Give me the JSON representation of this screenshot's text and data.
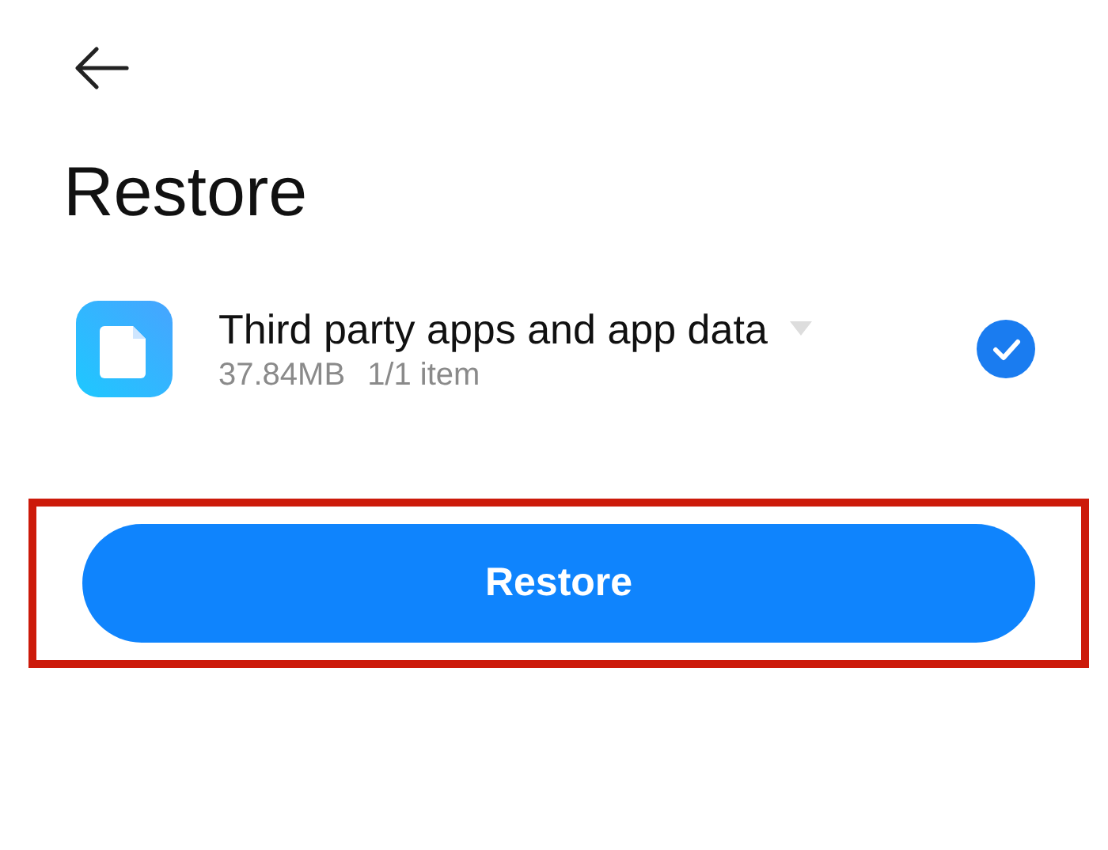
{
  "header": {
    "title": "Restore"
  },
  "items": [
    {
      "title": "Third party apps and app data",
      "size": "37.84MB",
      "count": "1/1 item",
      "checked": true
    }
  ],
  "restore_button": {
    "label": "Restore",
    "highlighted": true
  }
}
